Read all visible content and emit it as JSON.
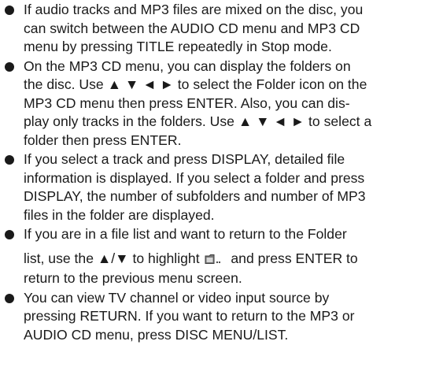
{
  "bullets": [
    {
      "lines": [
        "If audio tracks and MP3 files are mixed on the disc, you",
        "can switch between the AUDIO CD menu and MP3 CD",
        "menu by pressing TITLE repeatedly in Stop mode."
      ]
    },
    {
      "lines": [
        "On the MP3 CD menu, you can display the folders on",
        "the disc. Use ▲ ▼ ◄ ► to select the Folder icon on the",
        "MP3 CD menu then press ENTER. Also, you can dis-",
        "play only tracks in the folders. Use ▲ ▼ ◄ ► to select a",
        "folder then press ENTER."
      ]
    },
    {
      "lines": [
        "If you select a track and press DISPLAY, detailed file",
        "information is displayed. If you select a folder and press",
        "DISPLAY, the number of subfolders and number of MP3",
        "files in the folder are displayed."
      ]
    },
    {
      "lines": [
        "If you are in a file list and want to return to the Folder"
      ],
      "line2_before_icon": "list, use the ▲/▼ to highlight ",
      "line2_after_icon": " and press ENTER to",
      "line3": "return to the previous menu screen.",
      "icon": "folder-up-icon"
    },
    {
      "lines": [
        "You can view TV channel or video input source by",
        "pressing RETURN. If you want to return to the MP3 or",
        "AUDIO CD menu, press DISC MENU/LIST."
      ]
    }
  ]
}
